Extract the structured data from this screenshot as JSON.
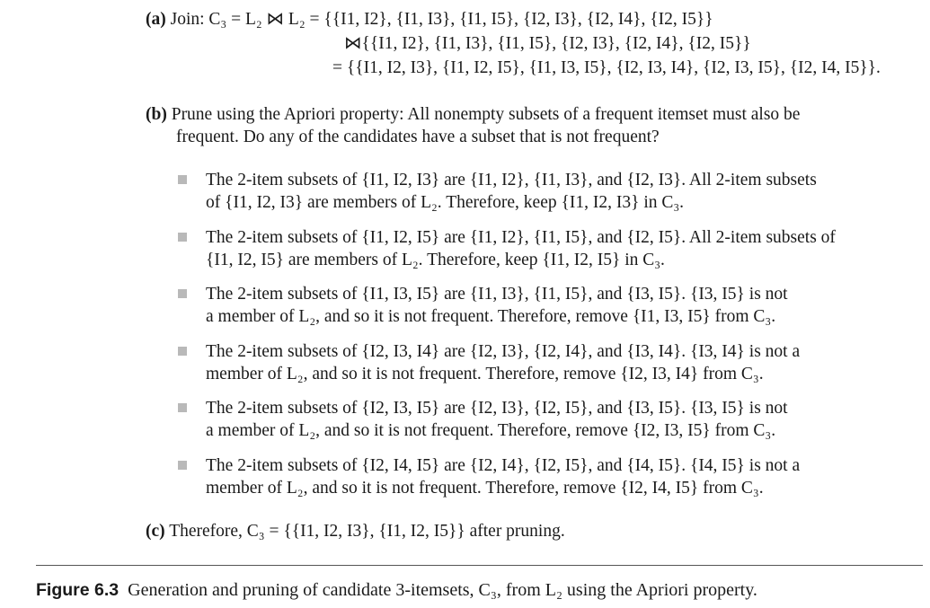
{
  "part_a": {
    "label": "(a)",
    "line1": "Join: C₃ = L₂ ⋈ L₂ = {{I1, I2}, {I1, I3}, {I1, I5}, {I2, I3}, {I2, I4}, {I2, I5}}",
    "line2": "⋈{{I1, I2}, {I1, I3}, {I1, I5}, {I2, I3}, {I2, I4}, {I2, I5}}",
    "line3": "= {{I1, I2, I3}, {I1, I2, I5}, {I1, I3, I5}, {I2, I3, I4}, {I2, I3, I5}, {I2, I4, I5}}."
  },
  "part_b": {
    "label": "(b)",
    "line1": "Prune using the Apriori property: All nonempty subsets of a frequent itemset must also be",
    "line2": "frequent. Do any of the candidates have a subset that is not frequent?",
    "bullets": [
      {
        "line1": "The 2-item subsets of {I1, I2, I3} are {I1, I2}, {I1, I3}, and {I2, I3}. All 2-item subsets",
        "line2": "of {I1, I2, I3} are members of L₂. Therefore, keep {I1, I2, I3} in C₃."
      },
      {
        "line1": "The 2-item subsets of {I1, I2, I5} are {I1, I2}, {I1, I5}, and {I2, I5}. All 2-item subsets of",
        "line2": "{I1, I2, I5} are members of L₂. Therefore, keep {I1, I2, I5} in C₃."
      },
      {
        "line1": "The 2-item subsets of {I1, I3, I5} are {I1, I3}, {I1, I5}, and {I3, I5}. {I3, I5} is not",
        "line2": "a member of L₂, and so it is not frequent. Therefore, remove {I1, I3, I5} from C₃."
      },
      {
        "line1": "The 2-item subsets of {I2, I3, I4} are {I2, I3}, {I2, I4}, and {I3, I4}. {I3, I4} is not a",
        "line2": "member of L₂, and so it is not frequent. Therefore, remove {I2, I3, I4} from C₃."
      },
      {
        "line1": "The 2-item subsets of {I2, I3, I5} are {I2, I3}, {I2, I5}, and {I3, I5}. {I3, I5} is not",
        "line2": "a member of L₂, and so it is not frequent. Therefore, remove {I2, I3, I5} from C₃."
      },
      {
        "line1": "The 2-item subsets of {I2, I4, I5} are {I2, I4}, {I2, I5}, and {I4, I5}. {I4, I5} is not a",
        "line2": "member of L₂, and so it is not frequent. Therefore, remove {I2, I4, I5} from C₃."
      }
    ]
  },
  "part_c": {
    "label": "(c)",
    "text": "Therefore, C₃ = {{I1, I2, I3}, {I1, I2, I5}} after pruning."
  },
  "caption": {
    "label": "Figure 6.3",
    "text": "Generation and pruning of candidate 3-itemsets, C₃, from L₂ using the Apriori property."
  }
}
